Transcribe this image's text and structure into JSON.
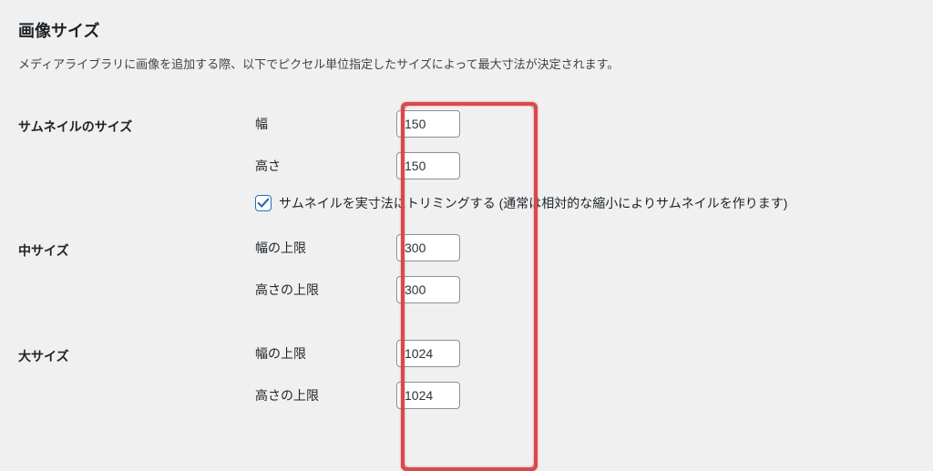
{
  "section": {
    "title": "画像サイズ",
    "desc": "メディアライブラリに画像を追加する際、以下でピクセル単位指定したサイズによって最大寸法が決定されます。"
  },
  "thumbnail": {
    "title": "サムネイルのサイズ",
    "width_label": "幅",
    "width_value": "150",
    "height_label": "高さ",
    "height_value": "150",
    "crop_checked": true,
    "crop_label": "サムネイルを実寸法にトリミングする (通常は相対的な縮小によりサムネイルを作ります)"
  },
  "medium": {
    "title": "中サイズ",
    "width_label": "幅の上限",
    "width_value": "300",
    "height_label": "高さの上限",
    "height_value": "300"
  },
  "large": {
    "title": "大サイズ",
    "width_label": "幅の上限",
    "width_value": "1024",
    "height_label": "高さの上限",
    "height_value": "1024"
  }
}
